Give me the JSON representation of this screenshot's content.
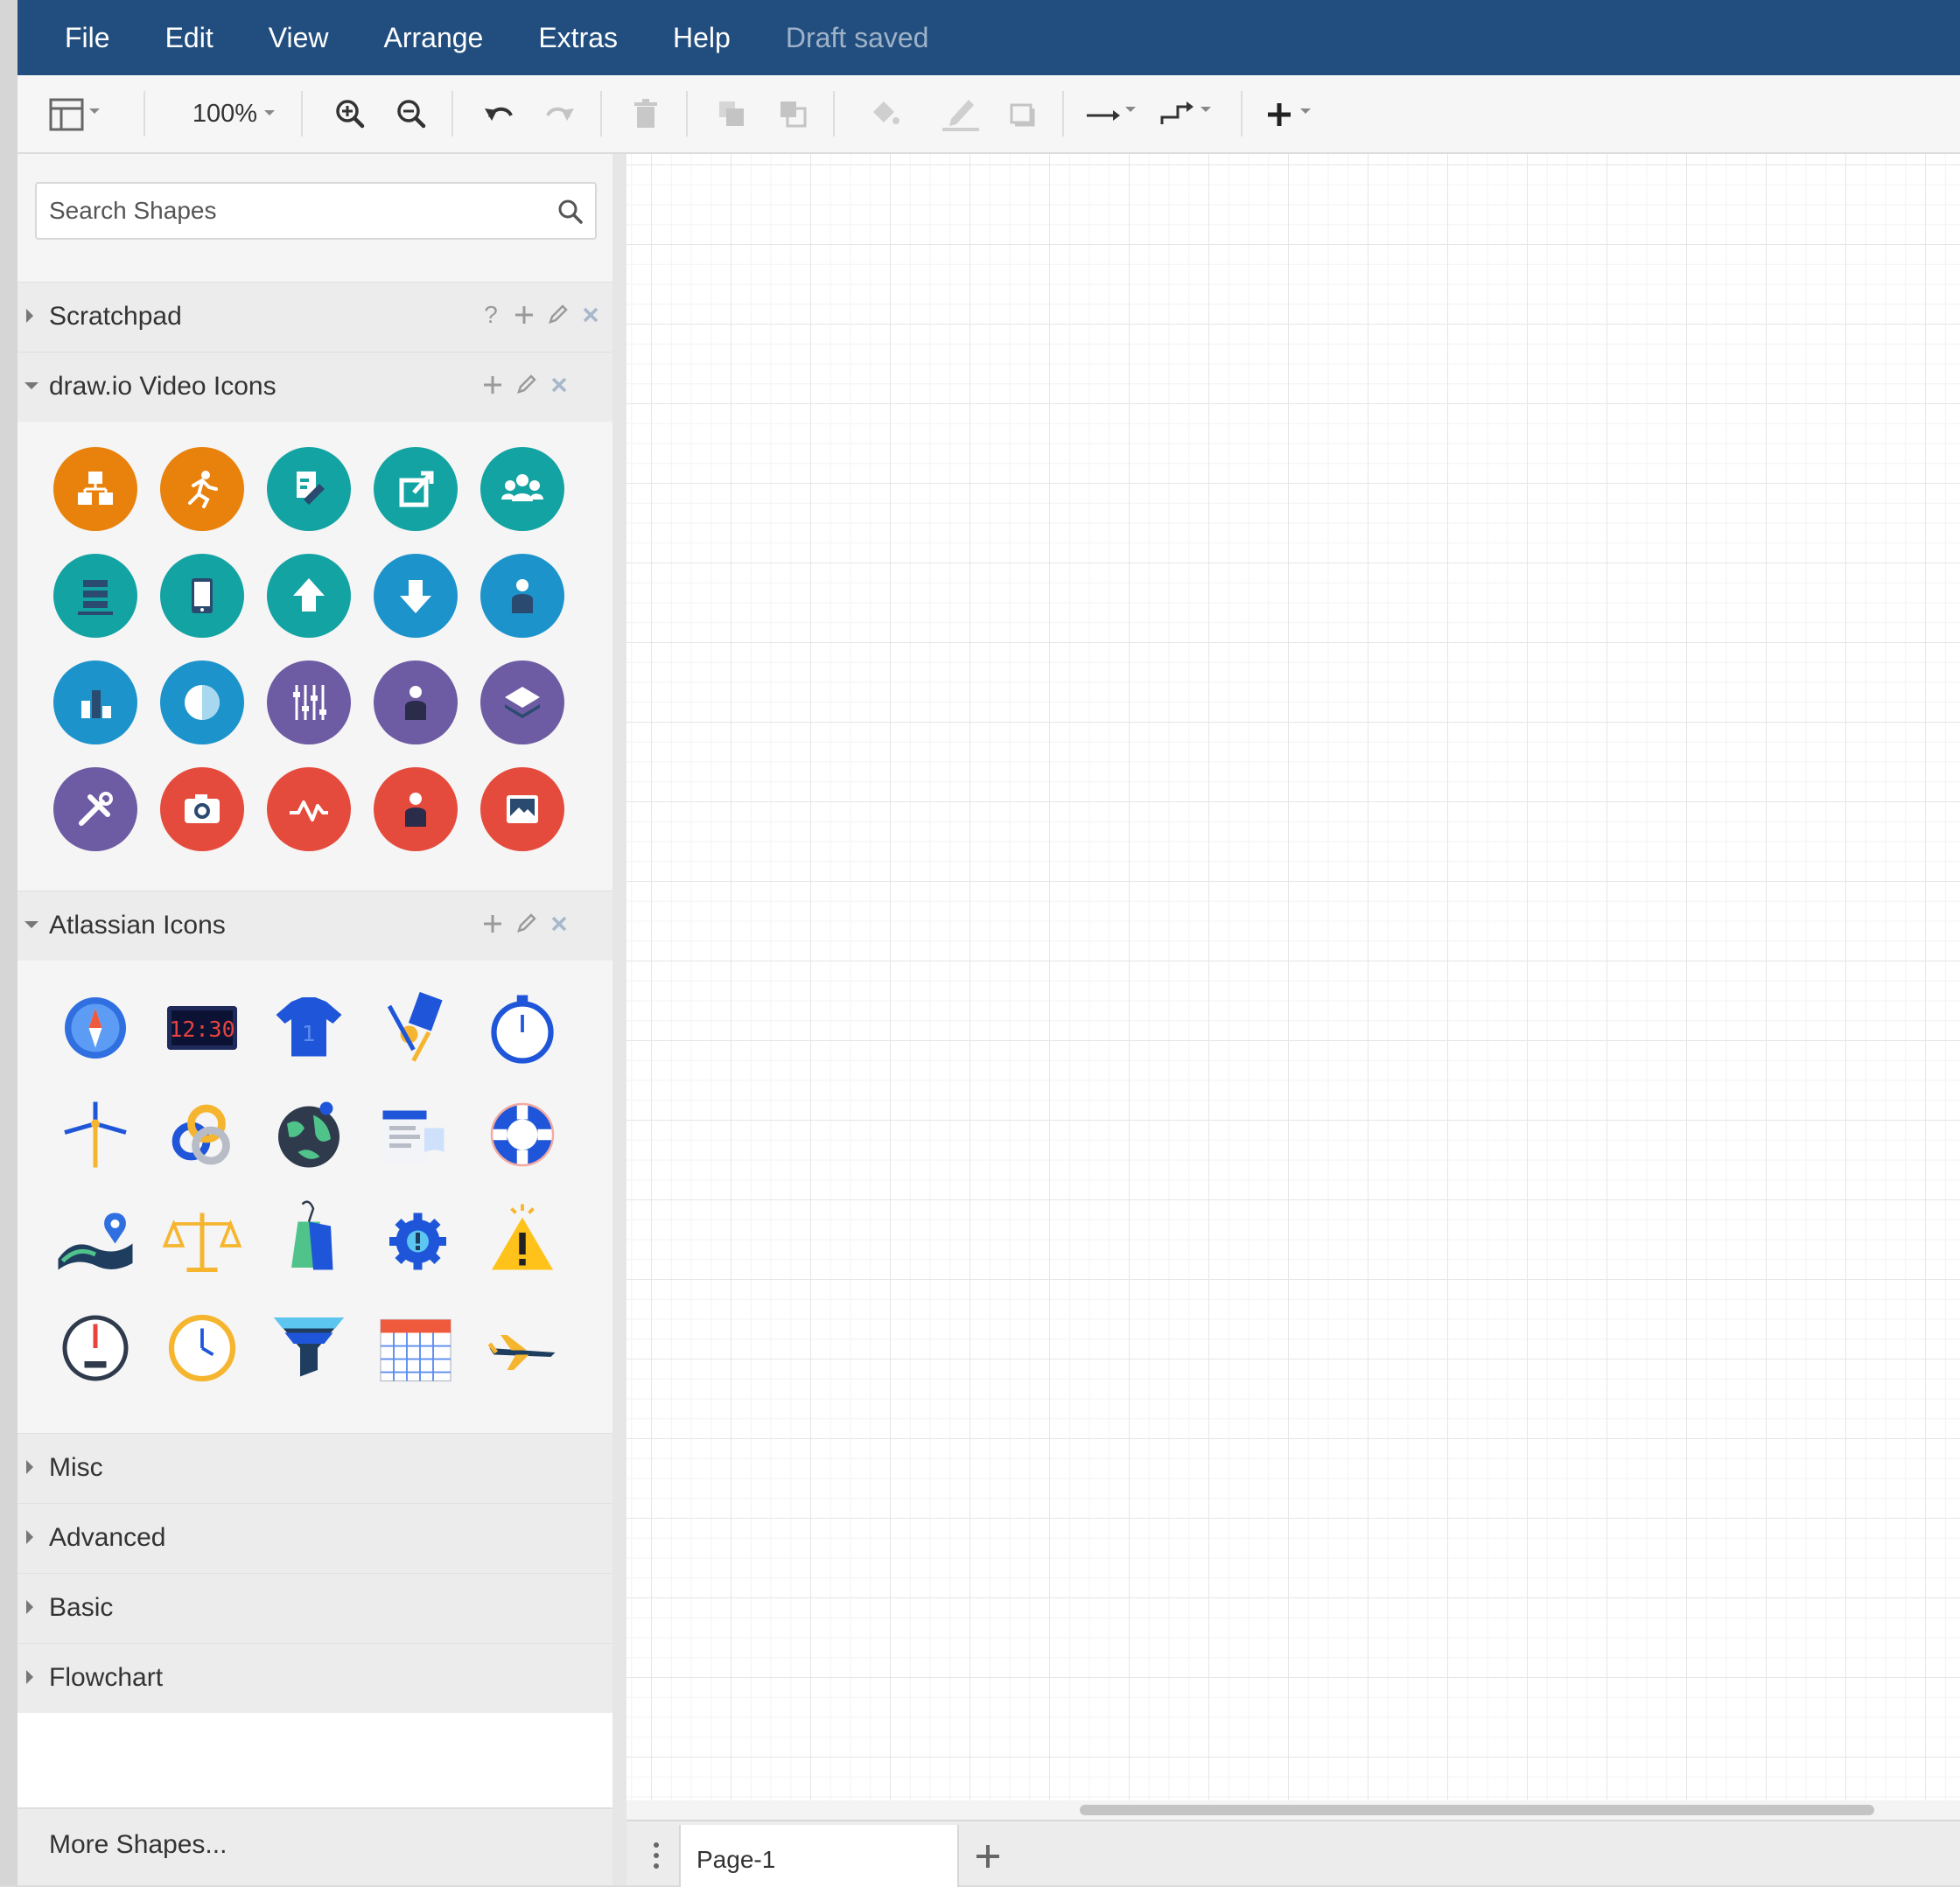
{
  "menubar": {
    "items": [
      "File",
      "Edit",
      "View",
      "Arrange",
      "Extras",
      "Help"
    ],
    "status": "Draft saved",
    "background": "#224e7f"
  },
  "toolbar": {
    "zoom": "100%",
    "buttons": [
      "format-panel",
      "zoom-in",
      "zoom-out",
      "undo",
      "redo",
      "delete",
      "to-front",
      "to-back",
      "fill-color",
      "line-color",
      "shadow",
      "connection-style",
      "waypoints",
      "insert"
    ]
  },
  "sidebar": {
    "search_placeholder": "Search Shapes",
    "sections": [
      {
        "title": "Scratchpad",
        "state": "collapsed"
      },
      {
        "title": "draw.io Video Icons",
        "state": "expanded"
      },
      {
        "title": "Atlassian Icons",
        "state": "expanded"
      },
      {
        "title": "Misc",
        "state": "collapsed"
      },
      {
        "title": "Advanced",
        "state": "collapsed"
      },
      {
        "title": "Basic",
        "state": "collapsed"
      },
      {
        "title": "Flowchart",
        "state": "collapsed"
      }
    ],
    "scratchpad_help": "?",
    "more_shapes": "More Shapes...",
    "video_icons": [
      {
        "name": "org-chart-icon",
        "color": "#e8820c"
      },
      {
        "name": "running-person-icon",
        "color": "#e8820c"
      },
      {
        "name": "edit-document-icon",
        "color": "#14a3a3"
      },
      {
        "name": "share-export-icon",
        "color": "#14a3a3"
      },
      {
        "name": "team-group-icon",
        "color": "#14a3a3"
      },
      {
        "name": "server-stack-icon",
        "color": "#14a3a3"
      },
      {
        "name": "tablet-device-icon",
        "color": "#14a3a3"
      },
      {
        "name": "upload-arrow-icon",
        "color": "#14a3a3"
      },
      {
        "name": "download-arrow-icon",
        "color": "#1d93cc"
      },
      {
        "name": "person-icon",
        "color": "#1d93cc"
      },
      {
        "name": "bar-chart-icon",
        "color": "#1d93cc"
      },
      {
        "name": "pie-chart-icon",
        "color": "#1d93cc"
      },
      {
        "name": "sliders-icon",
        "color": "#6d5ba3"
      },
      {
        "name": "user-icon",
        "color": "#6d5ba3"
      },
      {
        "name": "layers-icon",
        "color": "#6d5ba3"
      },
      {
        "name": "tools-icon",
        "color": "#6d5ba3"
      },
      {
        "name": "camera-icon",
        "color": "#e54b3c"
      },
      {
        "name": "activity-pulse-icon",
        "color": "#e54b3c"
      },
      {
        "name": "profile-icon",
        "color": "#e54b3c"
      },
      {
        "name": "picture-icon",
        "color": "#e54b3c"
      }
    ],
    "atlassian_icons": [
      "compass-icon",
      "digital-clock-icon",
      "jersey-icon",
      "design-tools-icon",
      "stopwatch-icon",
      "windmill-icon",
      "chain-rings-icon",
      "globe-icon",
      "documents-icon",
      "lifebuoy-icon",
      "map-pin-icon",
      "scales-icon",
      "price-tag-icon",
      "gear-alert-icon",
      "warning-icon",
      "speedometer-icon",
      "clock-icon",
      "funnel-icon",
      "calendar-icon",
      "airplane-icon"
    ]
  },
  "pages": {
    "tabs": [
      "Page-1"
    ]
  }
}
